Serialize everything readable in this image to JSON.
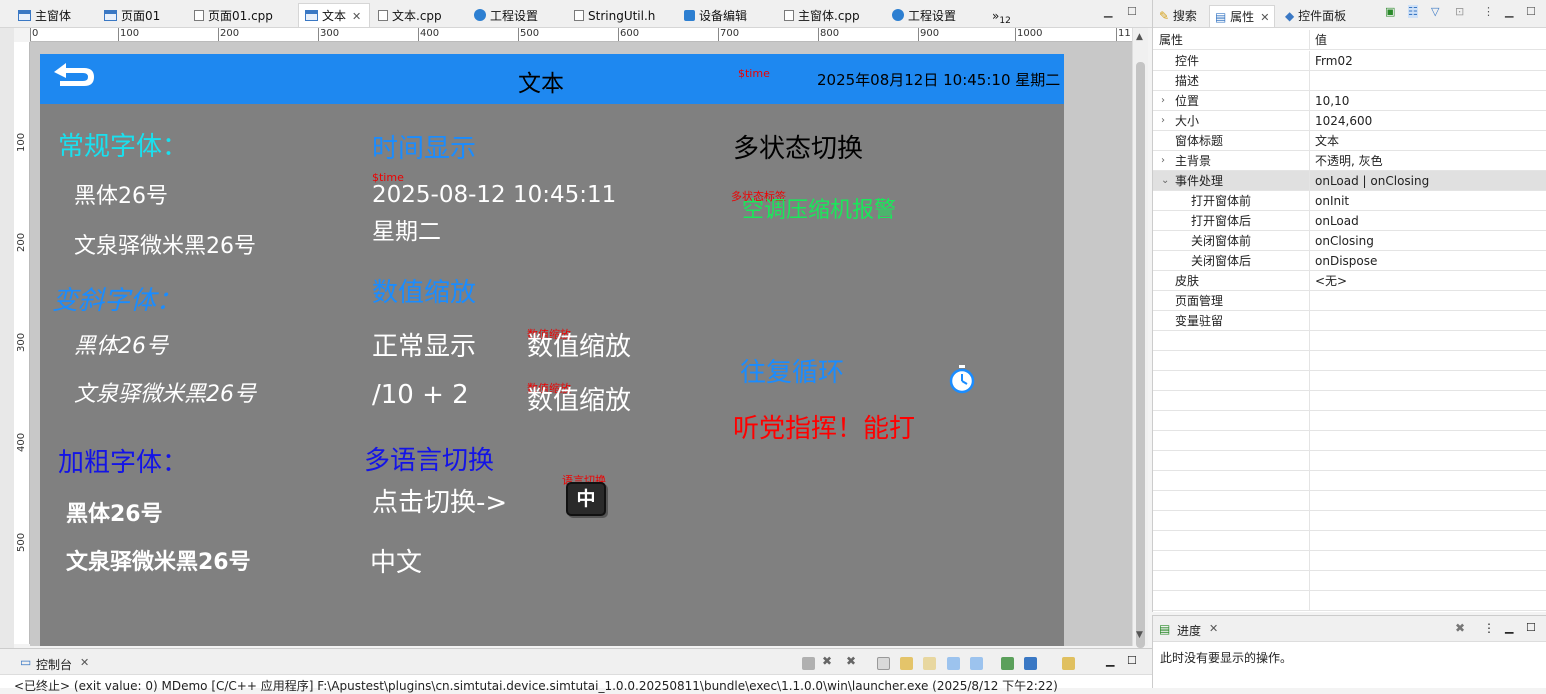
{
  "tabs": [
    {
      "label": "主窗体",
      "icon": "form-icon"
    },
    {
      "label": "页面01",
      "icon": "form-icon"
    },
    {
      "label": "页面01.cpp",
      "icon": "cpp-file-icon"
    },
    {
      "label": "文本",
      "icon": "form-icon",
      "active": true
    },
    {
      "label": "文本.cpp",
      "icon": "cpp-file-icon"
    },
    {
      "label": "工程设置",
      "icon": "gear-icon"
    },
    {
      "label": "StringUtil.h",
      "icon": "header-file-icon"
    },
    {
      "label": "设备编辑",
      "icon": "device-icon"
    },
    {
      "label": "主窗体.cpp",
      "icon": "cpp-file-icon"
    },
    {
      "label": "工程设置",
      "icon": "gear-icon"
    }
  ],
  "tab_overflow": {
    "symbol": "»",
    "count": "12"
  },
  "ruler": {
    "h_ticks": [
      "0",
      "100",
      "200",
      "300",
      "400",
      "500",
      "600",
      "700",
      "800",
      "900",
      "1000",
      "11"
    ],
    "v_ticks": [
      "100",
      "200",
      "300",
      "400",
      "500"
    ]
  },
  "form": {
    "title": "文本",
    "time_tag": "$time",
    "datetime": "2025年08月12日 10:45:10 星期二",
    "colors": {
      "titlebar": "#1e88f0",
      "background": "#808080"
    },
    "col1": {
      "regular_heading": "常规字体：",
      "regular_items": [
        "黑体26号",
        "文泉驿微米黑26号"
      ],
      "italic_heading": "变斜字体：",
      "italic_items": [
        "黑体26号",
        "文泉驿微米黑26号"
      ],
      "bold_heading": "加粗字体：",
      "bold_items": [
        "黑体26号",
        "文泉驿微米黑26号"
      ]
    },
    "col2": {
      "time_heading": "时间显示",
      "time_tag": "$time",
      "time_value": "2025-08-12 10:45:11",
      "weekday": "星期二",
      "scale_heading": "数值缩放",
      "normal_label": "正常显示",
      "scale_tag": "数值缩放",
      "scale_value": "数值缩放",
      "formula_label": "/10 + 2",
      "scale_tag2": "数值缩放",
      "scale_value2": "数值缩放",
      "lang_heading": "多语言切换",
      "click_switch": "点击切换->",
      "lang_tag": "语言切换",
      "lang_button": "中",
      "lang_value": "中文"
    },
    "col3": {
      "multistate_heading": "多状态切换",
      "multistate_tag": "多状态标签",
      "multistate_value": "空调压缩机报警",
      "loop_heading": "往复循环",
      "marquee_text": "听党指挥！能打"
    }
  },
  "right_panel": {
    "tabs": [
      {
        "label": "搜索",
        "icon": "search-icon"
      },
      {
        "label": "属性",
        "icon": "properties-icon",
        "active": true
      },
      {
        "label": "控件面板",
        "icon": "widget-palette-icon"
      }
    ],
    "header": {
      "key": "属性",
      "value": "值"
    },
    "rows": [
      {
        "key": "控件",
        "value": "Frm02",
        "indent": 1
      },
      {
        "key": "描述",
        "value": "",
        "indent": 1
      },
      {
        "key": "位置",
        "value": "10,10",
        "indent": 1,
        "expander": "›"
      },
      {
        "key": "大小",
        "value": "1024,600",
        "indent": 1,
        "expander": "›"
      },
      {
        "key": "窗体标题",
        "value": "文本",
        "indent": 1
      },
      {
        "key": "主背景",
        "value": "不透明, 灰色",
        "indent": 1,
        "expander": "›"
      },
      {
        "key": "事件处理",
        "value": "onLoad | onClosing",
        "indent": 1,
        "expander": "⌄",
        "selected": true
      },
      {
        "key": "打开窗体前",
        "value": "onInit",
        "indent": 2
      },
      {
        "key": "打开窗体后",
        "value": "onLoad",
        "indent": 2
      },
      {
        "key": "关闭窗体前",
        "value": "onClosing",
        "indent": 2
      },
      {
        "key": "关闭窗体后",
        "value": "onDispose",
        "indent": 2
      },
      {
        "key": "皮肤",
        "value": "<无>",
        "indent": 1
      },
      {
        "key": "页面管理",
        "value": "",
        "indent": 1
      },
      {
        "key": "变量驻留",
        "value": "",
        "indent": 1
      }
    ]
  },
  "progress": {
    "title": "进度",
    "message": "此时没有要显示的操作。"
  },
  "console": {
    "title": "控制台",
    "output": "<已终止> (exit value: 0) MDemo [C/C++ 应用程序] F:\\Apustest\\plugins\\cn.simtutai.device.simtutai_1.0.0.20250811\\bundle\\exec\\1.1.0.0\\win\\launcher.exe (2025/8/12 下午2:22)"
  }
}
